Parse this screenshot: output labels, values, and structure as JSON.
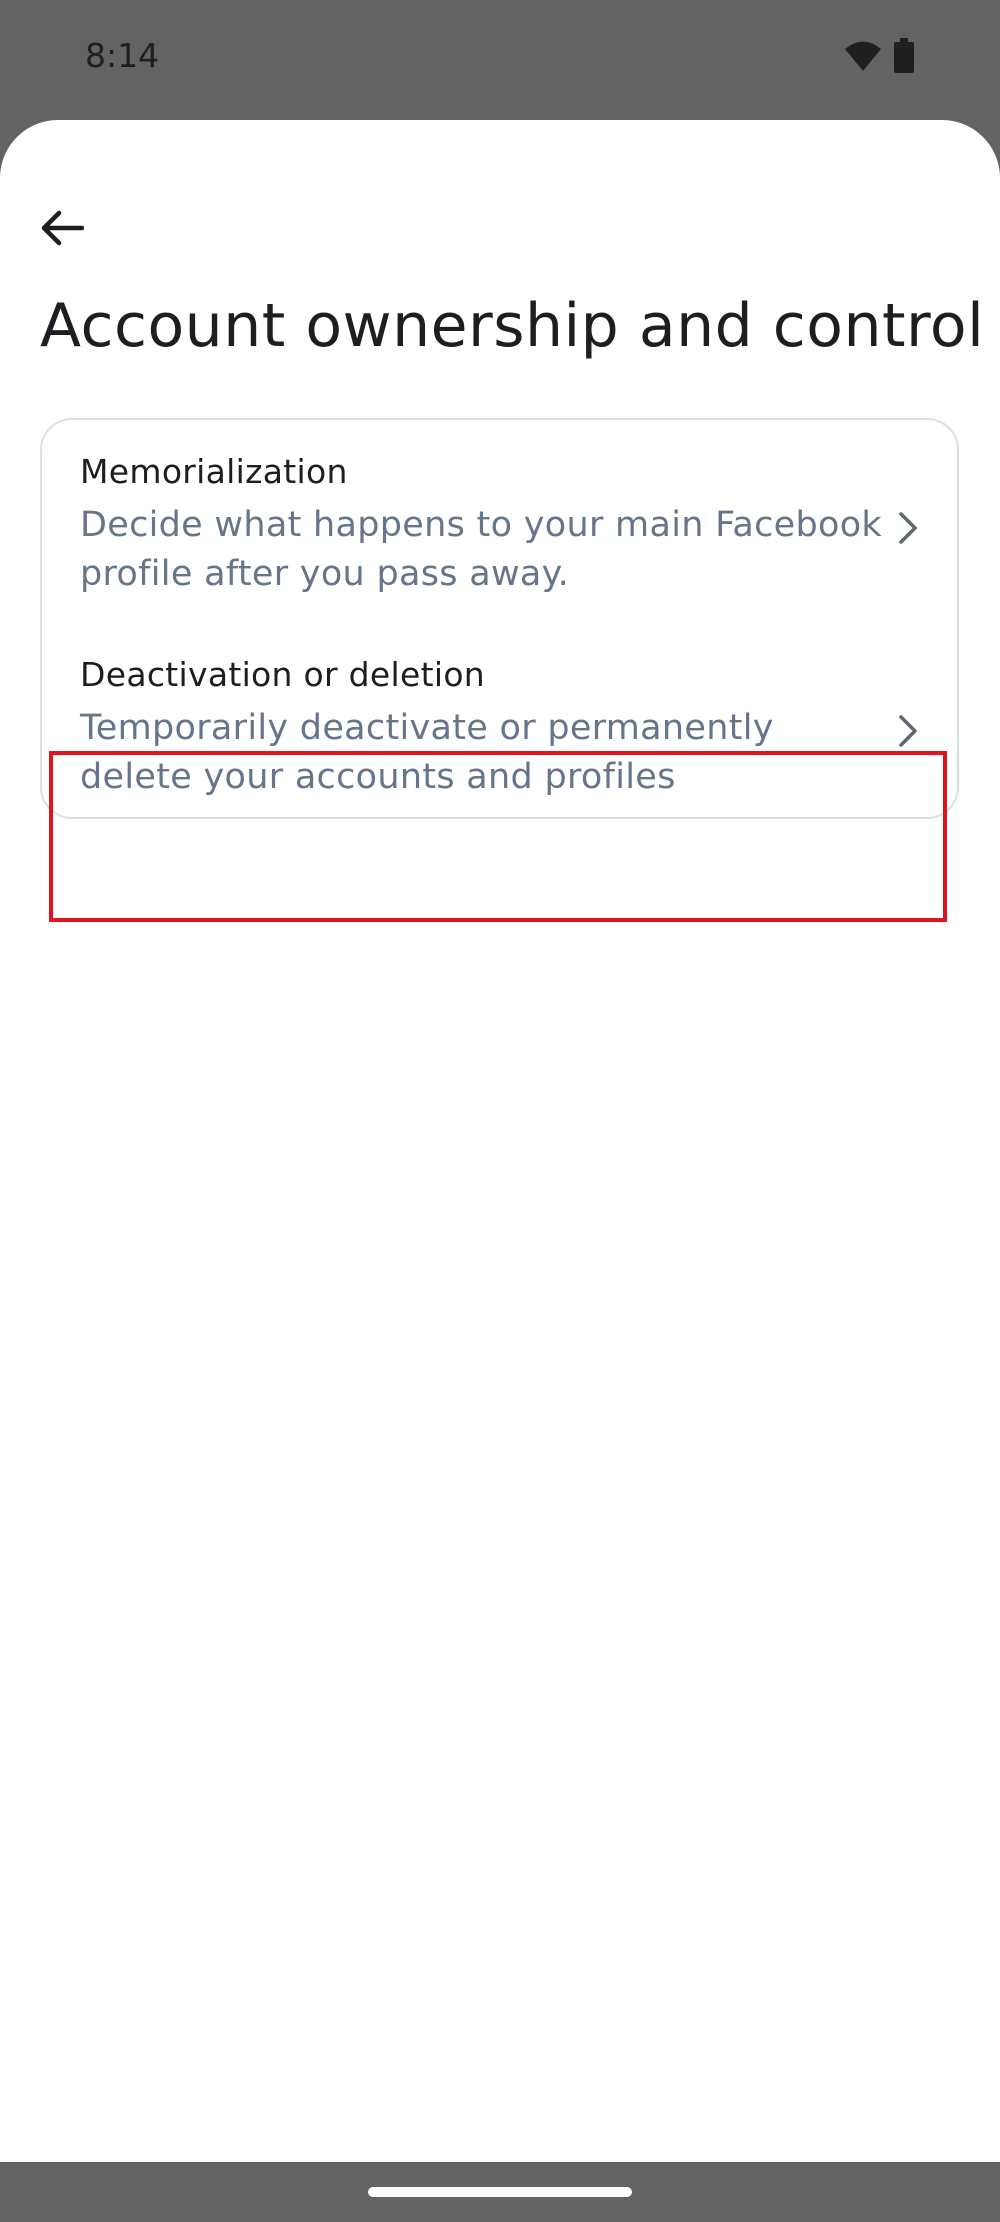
{
  "status_bar": {
    "time": "8:14",
    "wifi_icon": "wifi-icon",
    "battery_icon": "battery-icon"
  },
  "header": {
    "back_icon": "arrow-left-icon",
    "title": "Account ownership and control"
  },
  "options": [
    {
      "title": "Memorialization",
      "description": "Decide what happens to your main Facebook profile after you pass away.",
      "icon": "chevron-right-icon"
    },
    {
      "title": "Deactivation or deletion",
      "description": "Temporarily deactivate or permanently delete your accounts and profiles",
      "icon": "chevron-right-icon"
    }
  ],
  "colors": {
    "highlight": "#e0141e",
    "scrim": "#636363",
    "title_text": "#1c1e21",
    "secondary_text": "#65758a"
  }
}
